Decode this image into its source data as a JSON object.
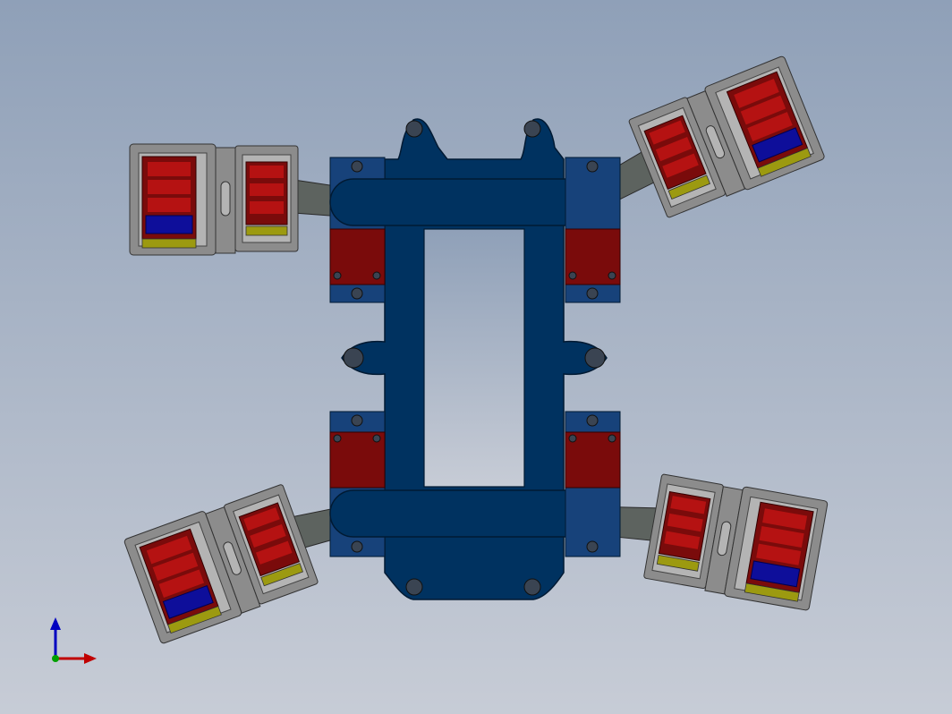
{
  "viewport": {
    "background_top": "#8fa0b8",
    "background_bottom": "#c7ccd6"
  },
  "colors": {
    "chassis": "#003260",
    "chassis_edge": "#001a33",
    "mount_block": "#17427a",
    "hole": "#3a4452",
    "servo_red": "#7a0b0b",
    "servo_red_light": "#b51212",
    "bracket_gray": "#8c8c8c",
    "bracket_light": "#b4b4b4",
    "arm_gray": "#5d635f",
    "servo_blue": "#0e0e9a",
    "servo_yellow": "#9c9a10"
  },
  "model": {
    "legs": [
      "leg-front-left",
      "leg-front-right",
      "leg-rear-left",
      "leg-rear-right"
    ]
  },
  "triad": {
    "x_color": "#c00000",
    "y_color": "#0000c0",
    "z_color": "#00a000"
  }
}
